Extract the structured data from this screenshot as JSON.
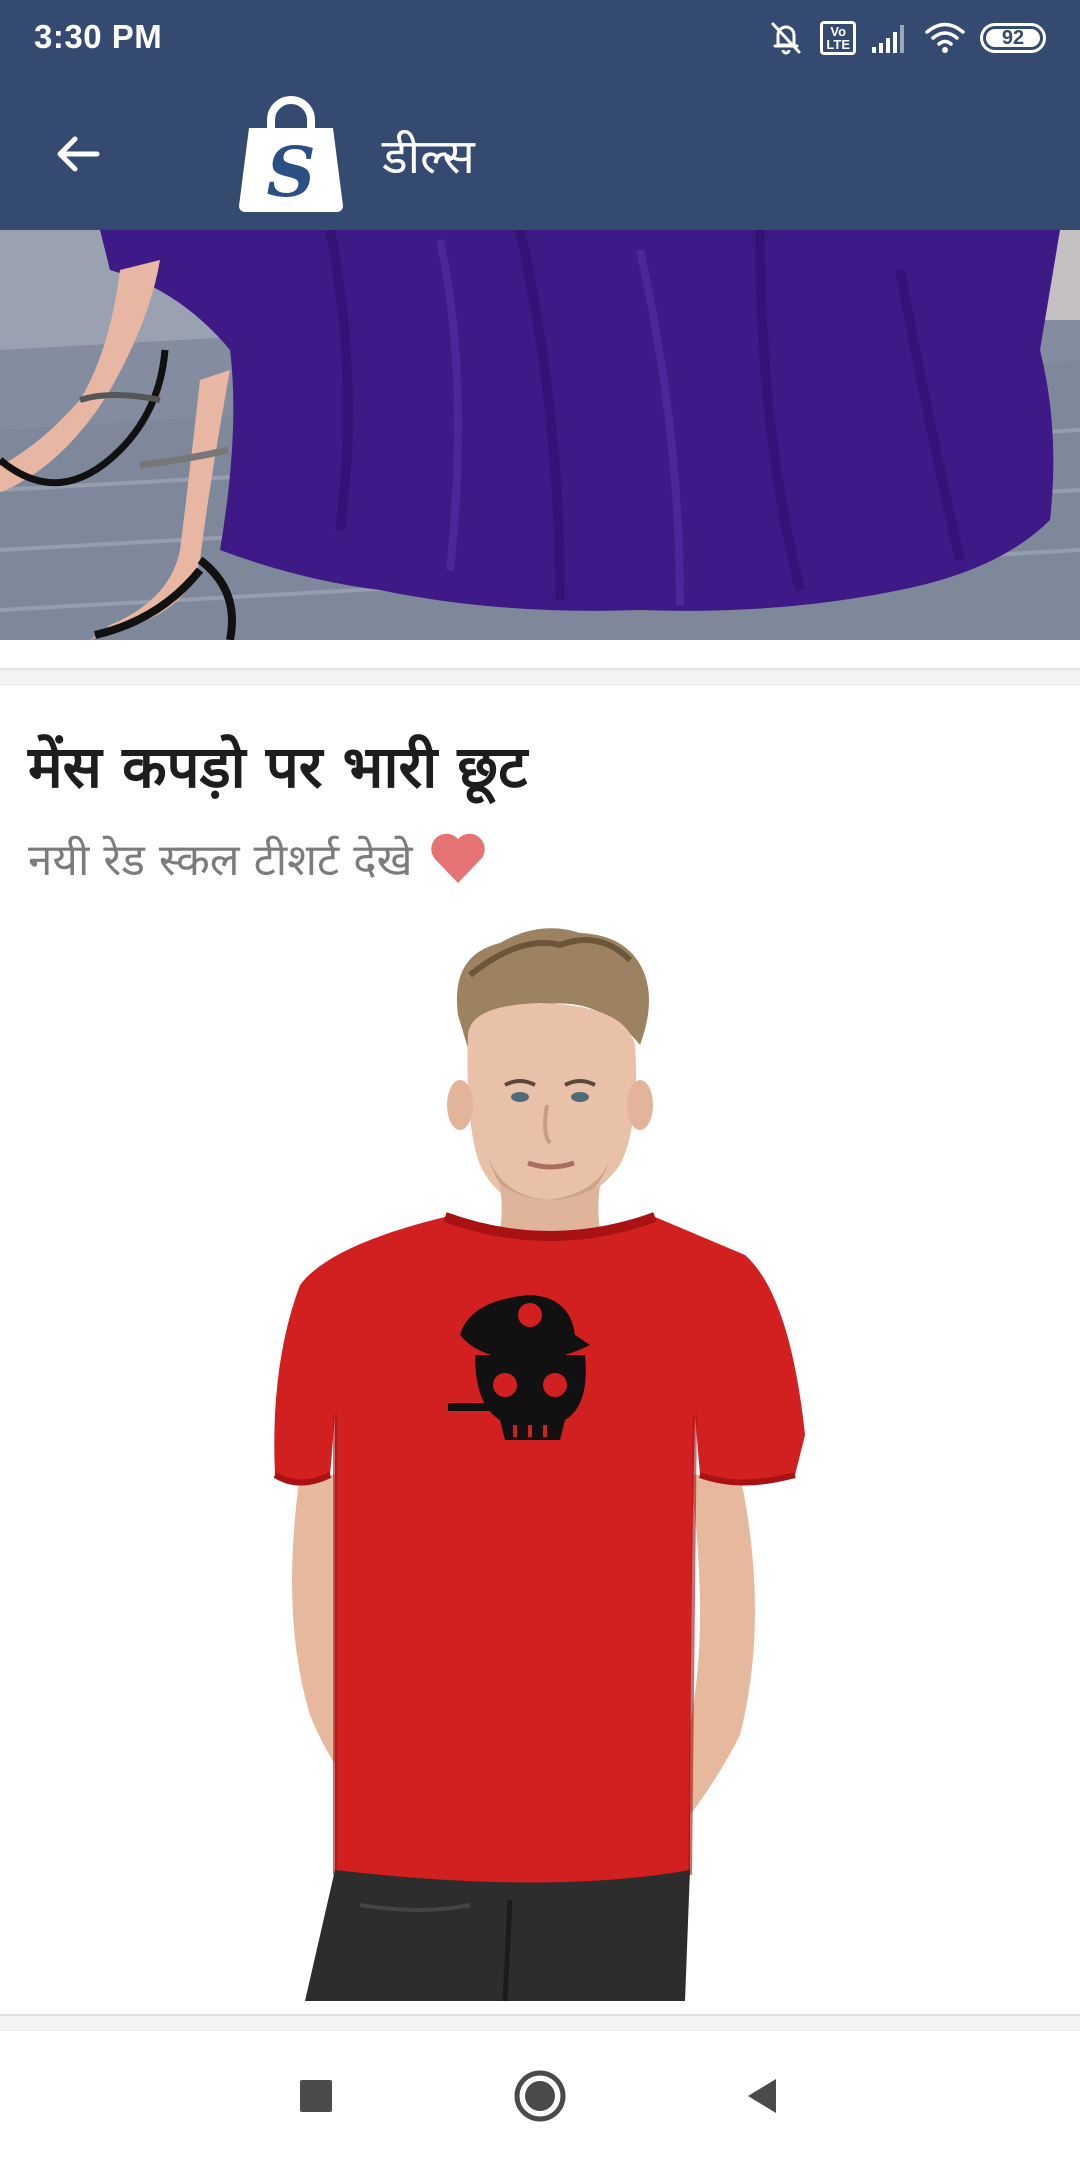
{
  "status_bar": {
    "time": "3:30 PM",
    "volte_label": "Vo LTE",
    "battery": "92",
    "icons": [
      "mute-icon",
      "volte-icon",
      "signal-icon",
      "wifi-icon",
      "battery-icon"
    ]
  },
  "app_bar": {
    "title": "डील्स",
    "logo_letter": "S",
    "back_icon": "arrow-left-icon"
  },
  "deals": [
    {
      "image": "purple-gown-heels-photo"
    },
    {
      "title": "मेंस कपड़ो पर भारी छूट",
      "subtitle": "नयी रेड स्कल टीशर्ट देखे",
      "subtitle_icon": "heart-icon",
      "image": "red-skull-tshirt-model-photo"
    }
  ],
  "nav_bar": {
    "buttons": [
      "recents-square-icon",
      "home-circle-icon",
      "back-triangle-icon"
    ]
  },
  "colors": {
    "app_bar": "#344a70",
    "shirt": "#d21f1f",
    "gown": "#3e1a86",
    "heart": "#e57373"
  }
}
